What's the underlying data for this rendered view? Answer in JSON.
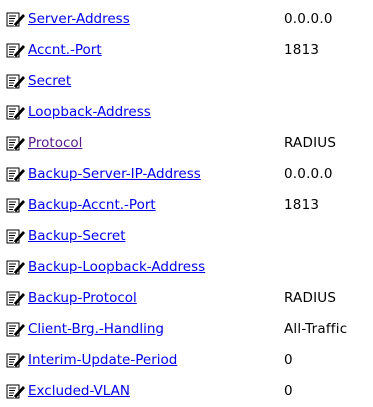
{
  "colors": {
    "link": "#0000ee",
    "visited_link": "#551a8b",
    "text": "#000000",
    "background": "#ffffff"
  },
  "icon": "edit-notepad-icon",
  "parameters": [
    {
      "name": "Server-Address",
      "value": "0.0.0.0",
      "visited": false
    },
    {
      "name": "Accnt.-Port",
      "value": "1813",
      "visited": false
    },
    {
      "name": "Secret",
      "value": "",
      "visited": false
    },
    {
      "name": "Loopback-Address",
      "value": "",
      "visited": false
    },
    {
      "name": "Protocol",
      "value": "RADIUS",
      "visited": true
    },
    {
      "name": "Backup-Server-IP-Address",
      "value": "0.0.0.0",
      "visited": false
    },
    {
      "name": "Backup-Accnt.-Port",
      "value": "1813",
      "visited": false
    },
    {
      "name": "Backup-Secret",
      "value": "",
      "visited": false
    },
    {
      "name": "Backup-Loopback-Address",
      "value": "",
      "visited": false
    },
    {
      "name": "Backup-Protocol",
      "value": "RADIUS",
      "visited": false
    },
    {
      "name": "Client-Brg.-Handling",
      "value": "All-Traffic",
      "visited": false
    },
    {
      "name": "Interim-Update-Period",
      "value": "0",
      "visited": false
    },
    {
      "name": "Excluded-VLAN",
      "value": "0",
      "visited": false
    }
  ]
}
